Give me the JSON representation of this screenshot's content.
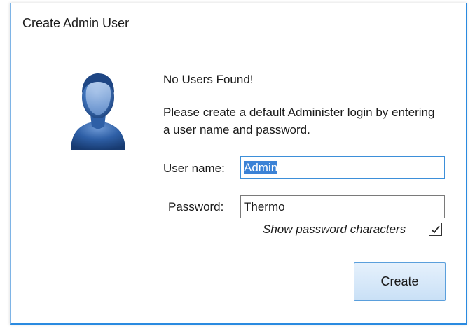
{
  "window": {
    "title": "Create Admin User"
  },
  "icons": {
    "user_avatar": "user-silhouette-icon",
    "checkmark": "checkmark-icon"
  },
  "message": {
    "title": "No Users Found!",
    "body": "Please create a default Administer login by entering a user name and password."
  },
  "form": {
    "username_label": "User name:",
    "username_value": "Admin",
    "password_label": "Password:",
    "password_value": "Thermo",
    "show_password_label": "Show password characters",
    "show_password_checked": true
  },
  "buttons": {
    "create_label": "Create"
  },
  "colors": {
    "accent": "#2a8ae0",
    "selection": "#3b82d6",
    "avatar": "#2f5fa0"
  }
}
